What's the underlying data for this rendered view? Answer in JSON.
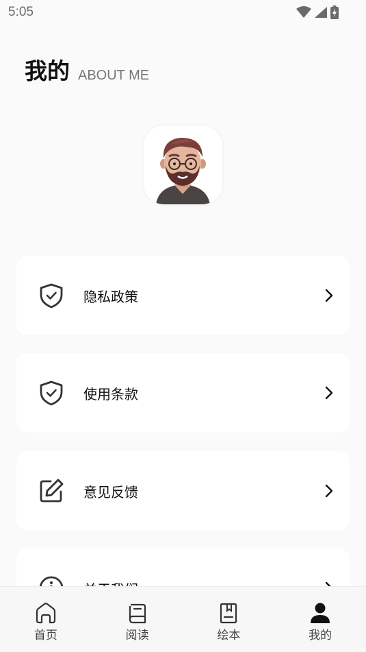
{
  "status_bar": {
    "time": "5:05"
  },
  "header": {
    "title": "我的",
    "subtitle": "ABOUT ME"
  },
  "menu": [
    {
      "label": "隐私政策",
      "icon": "shield-check-icon"
    },
    {
      "label": "使用条款",
      "icon": "shield-check-icon"
    },
    {
      "label": "意见反馈",
      "icon": "edit-icon"
    },
    {
      "label": "关于我们",
      "icon": "info-icon"
    }
  ],
  "tabs": [
    {
      "label": "首页",
      "icon": "home-icon",
      "active": false
    },
    {
      "label": "阅读",
      "icon": "book-icon",
      "active": false
    },
    {
      "label": "绘本",
      "icon": "bookmark-book-icon",
      "active": false
    },
    {
      "label": "我的",
      "icon": "user-icon",
      "active": true
    }
  ]
}
